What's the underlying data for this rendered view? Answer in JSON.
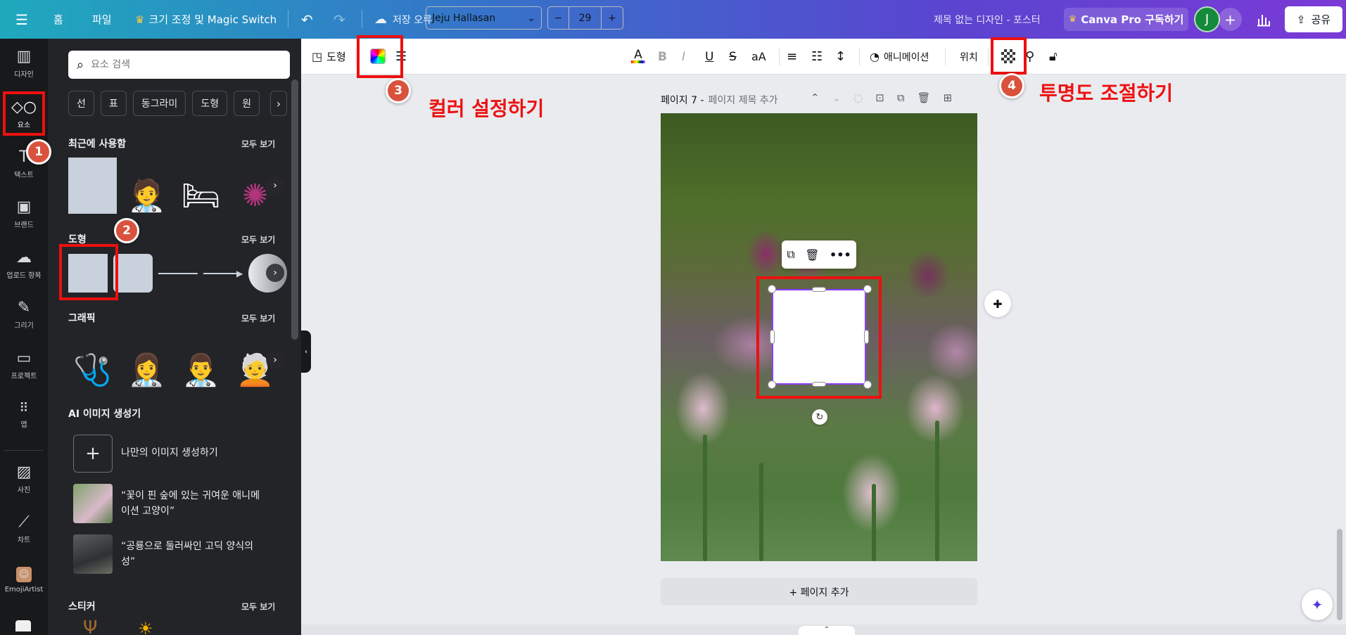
{
  "topbar": {
    "home": "홈",
    "file": "파일",
    "resize": "크기 조정 및 Magic Switch",
    "save_status": "저장 오류",
    "doc_title": "제목 없는 디자인 - 포스터",
    "pro": "Canva Pro 구독하기",
    "avatar_letter": "J",
    "share": "공유"
  },
  "rail": {
    "items": [
      {
        "label": "디자인",
        "icon": "layout-icon"
      },
      {
        "label": "요소",
        "icon": "shapes-icon"
      },
      {
        "label": "텍스트",
        "icon": "text-icon"
      },
      {
        "label": "브랜드",
        "icon": "brand-icon"
      },
      {
        "label": "업로드 항목",
        "icon": "upload-icon"
      },
      {
        "label": "그리기",
        "icon": "draw-icon"
      },
      {
        "label": "프로젝트",
        "icon": "folder-icon"
      },
      {
        "label": "앱",
        "icon": "apps-icon"
      },
      {
        "label": "사진",
        "icon": "photo-icon"
      },
      {
        "label": "차트",
        "icon": "chart-icon"
      },
      {
        "label": "EmojiArtist",
        "icon": "emoji-artist-icon"
      }
    ]
  },
  "panel": {
    "search_placeholder": "요소 검색",
    "chips": [
      "선",
      "표",
      "동그라미",
      "도형",
      "원"
    ],
    "see_all": "모두 보기",
    "recent_title": "최근에 사용함",
    "shapes_title": "도형",
    "graphics_title": "그래픽",
    "ai_title": "AI 이미지 생성기",
    "ai_items": [
      "나만의 이미지 생성하기",
      "“꽃이 핀 숲에 있는 귀여운 애니메이션 고양이”",
      "“공룡으로 둘러싸인 고딕 양식의 성”"
    ],
    "stickers_title": "스티커"
  },
  "toolbar": {
    "shape": "도형",
    "font": "Jeju Hallasan",
    "size": "29",
    "minus": "−",
    "plus": "+",
    "case": "aA",
    "animate": "애니메이션",
    "position": "위치"
  },
  "canvas": {
    "page_label": "페이지 7 -",
    "page_title_placeholder": "페이지 제목 추가",
    "add_page": "+ 페이지 추가"
  },
  "annotations": {
    "badges": [
      "1",
      "2",
      "3",
      "4"
    ],
    "color_note": "컬러 설정하기",
    "transparency_note": "투명도 조절하기",
    "color": "#ee1111"
  }
}
